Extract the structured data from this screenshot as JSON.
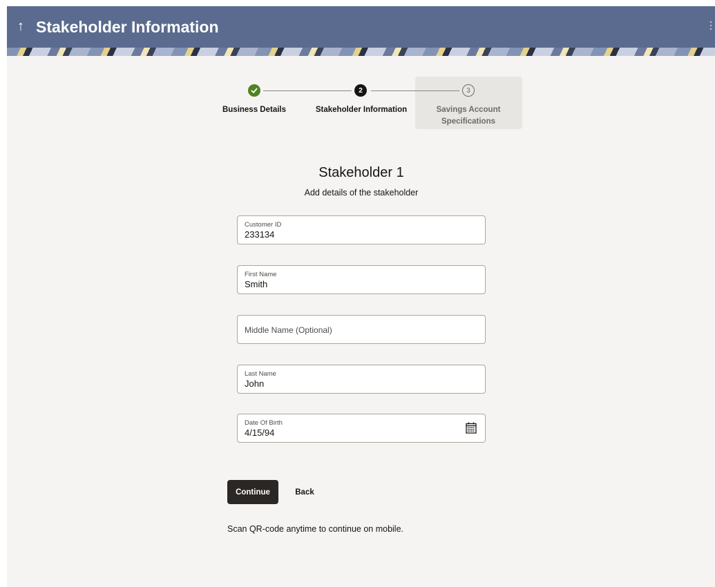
{
  "header": {
    "back_icon": "up-arrow-icon",
    "title": "Stakeholder Information",
    "menu_icon": "kebab-icon"
  },
  "stepper": {
    "steps": [
      {
        "number": "",
        "label": "Business Details",
        "state": "completed"
      },
      {
        "number": "2",
        "label": "Stakeholder Information",
        "state": "current"
      },
      {
        "number": "3",
        "label": "Savings Account Specifications",
        "state": "pending"
      }
    ]
  },
  "section": {
    "title": "Stakeholder 1",
    "subtitle": "Add details of the stakeholder"
  },
  "form": {
    "customer_id": {
      "label": "Customer ID",
      "value": "233134"
    },
    "first_name": {
      "label": "First Name",
      "value": "Smith"
    },
    "middle_name": {
      "placeholder": "Middle Name (Optional)"
    },
    "last_name": {
      "label": "Last Name",
      "value": "John"
    },
    "dob": {
      "label": "Date Of Birth",
      "value": "4/15/94",
      "icon": "calendar-icon"
    }
  },
  "actions": {
    "continue_label": "Continue",
    "back_label": "Back"
  },
  "footer": {
    "qr_note": "Scan QR-code anytime to continue on mobile."
  },
  "colors": {
    "header": "#5b6b8f",
    "background": "#f5f4f2",
    "success": "#508223",
    "primary_button": "#2b2724"
  }
}
